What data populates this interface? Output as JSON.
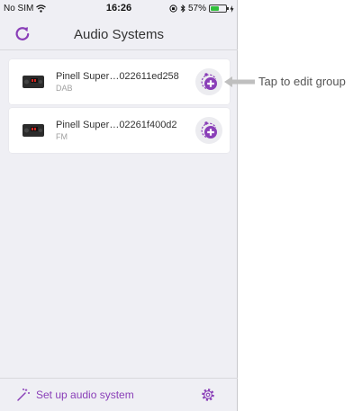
{
  "status_bar": {
    "carrier": "No SIM",
    "time": "16:26",
    "battery": "57%",
    "battery_level": 0.57
  },
  "nav": {
    "title": "Audio Systems",
    "refresh_icon": "refresh-icon"
  },
  "devices": [
    {
      "name": "Pinell Super…022611ed258",
      "band": "DAB",
      "action_icon": "add-group-icon"
    },
    {
      "name": "Pinell Super…02261f400d2",
      "band": "FM",
      "action_icon": "add-group-icon"
    }
  ],
  "callout": {
    "text": "Tap to edit group"
  },
  "footer": {
    "setup_label": "Set up audio system",
    "setup_icon": "magic-wand-icon",
    "settings_icon": "gear-icon"
  },
  "colors": {
    "accent": "#8a3fb8",
    "background": "#efeff4",
    "card": "#ffffff",
    "battery": "#2fbf3a"
  }
}
